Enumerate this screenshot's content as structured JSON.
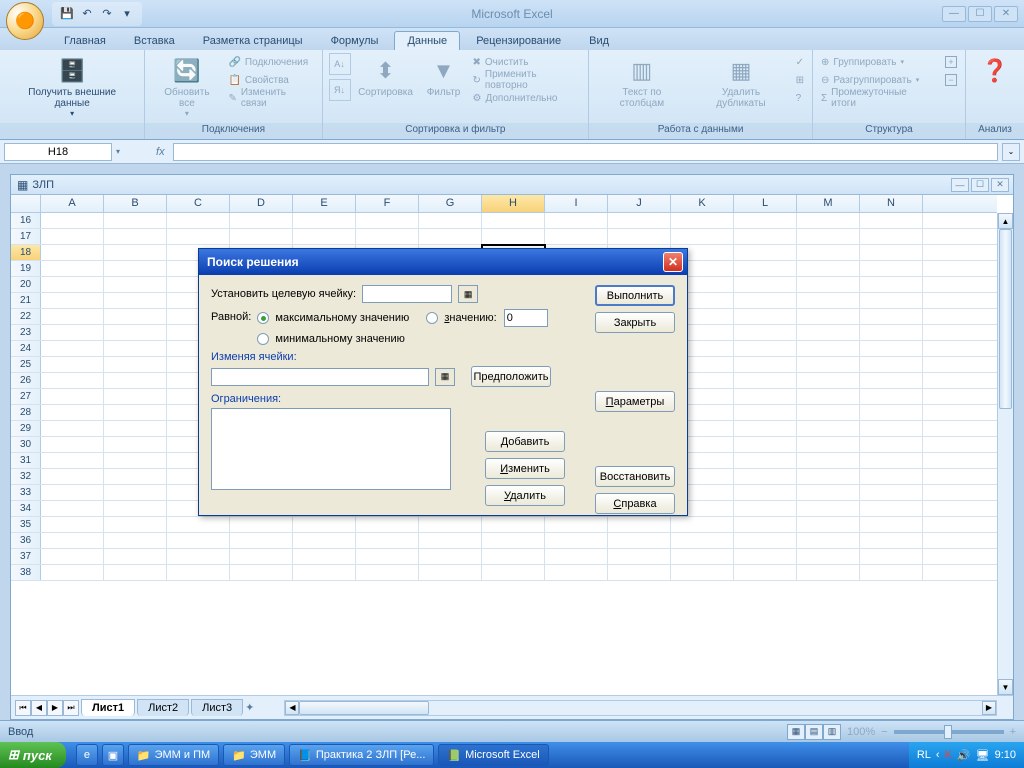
{
  "app": {
    "title": "Microsoft Excel"
  },
  "qat": {
    "save": "💾",
    "undo": "↶",
    "redo": "↷"
  },
  "tabs": [
    "Главная",
    "Вставка",
    "Разметка страницы",
    "Формулы",
    "Данные",
    "Рецензирование",
    "Вид"
  ],
  "active_tab_index": 4,
  "ribbon": {
    "ext_data": "Получить внешние данные",
    "connections": {
      "refresh": "Обновить все",
      "conn": "Подключения",
      "props": "Свойства",
      "edit": "Изменить связи",
      "group": "Подключения"
    },
    "sort": {
      "az": "А↓Я",
      "za": "Я↓А",
      "sort": "Сортировка",
      "filter": "Фильтр",
      "clear": "Очистить",
      "reapply": "Применить повторно",
      "adv": "Дополнительно",
      "group": "Сортировка и фильтр"
    },
    "data": {
      "t2c": "Текст по столбцам",
      "dup": "Удалить дубликаты",
      "group": "Работа с данными"
    },
    "outline": {
      "grp": "Группировать",
      "ungrp": "Разгруппировать",
      "sub": "Промежуточные итоги",
      "group": "Структура"
    },
    "analysis": {
      "label": "Анализ"
    }
  },
  "namebox": "H18",
  "fx": "fx",
  "workbook": {
    "title": "ЗЛП"
  },
  "columns": [
    "A",
    "B",
    "C",
    "D",
    "E",
    "F",
    "G",
    "H",
    "I",
    "J",
    "K",
    "L",
    "M",
    "N"
  ],
  "sel_col": "H",
  "rows": [
    16,
    17,
    18,
    19,
    20,
    21,
    22,
    23,
    24,
    25,
    26,
    27,
    28,
    29,
    30,
    31,
    32,
    33,
    34,
    35,
    36,
    37,
    38
  ],
  "sel_row": 18,
  "sheets": [
    "Лист1",
    "Лист2",
    "Лист3"
  ],
  "active_sheet": 0,
  "status": "Ввод",
  "zoom": "100%",
  "lang": "RU",
  "dialog": {
    "title": "Поиск решения",
    "target_label": "Установить целевую ячейку:",
    "equal_label": "Равной:",
    "opt_max": "максимальному значению",
    "opt_min": "минимальному значению",
    "opt_val": "значению:",
    "val_input": "0",
    "changing_label": "Изменяя ячейки:",
    "guess": "Предположить",
    "constraints_label": "Ограничения:",
    "add": "Добавить",
    "change": "Изменить",
    "delete": "Удалить",
    "run": "Выполнить",
    "close": "Закрыть",
    "params": "Параметры",
    "restore": "Восстановить",
    "help": "Справка"
  },
  "taskbar": {
    "start": "пуск",
    "items": [
      "ЭММ и ПМ",
      "ЭММ",
      "Практика 2 ЗЛП [Ре...",
      "Microsoft Excel"
    ],
    "time": "9:10",
    "lang": "RL"
  }
}
